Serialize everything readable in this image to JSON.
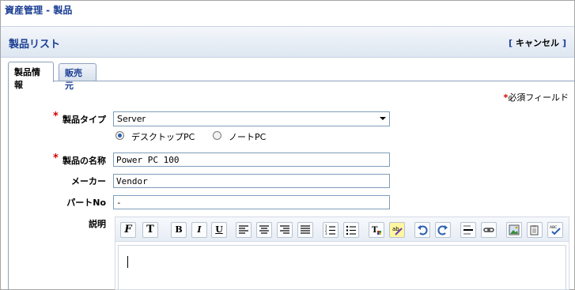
{
  "app": {
    "title": "資産管理 - 製品"
  },
  "header": {
    "title": "製品リスト",
    "cancel_open": "[",
    "cancel_label": "キャンセル",
    "cancel_close": "]"
  },
  "tabs": [
    {
      "label": "製品情報",
      "active": true
    },
    {
      "label": "販売元",
      "active": false
    }
  ],
  "form": {
    "required_star": "*",
    "required_note": "必須フィールド",
    "product_type": {
      "label": "製品タイプ",
      "value": "Server"
    },
    "category": {
      "options": [
        {
          "label": "デスクトップPC",
          "checked": true
        },
        {
          "label": "ノートPC",
          "checked": false
        }
      ]
    },
    "product_name": {
      "label": "製品の名称",
      "value": "Power PC 100"
    },
    "manufacturer": {
      "label": "メーカー",
      "value": "Vendor"
    },
    "part_no": {
      "label": "パートNo",
      "value": "-"
    },
    "description": {
      "label": "説明",
      "value": ""
    }
  },
  "toolbar": {
    "icons": [
      "font-family-icon",
      "font-size-icon",
      "bold-icon",
      "italic-icon",
      "underline-icon",
      "align-left-icon",
      "align-center-icon",
      "align-right-icon",
      "justify-icon",
      "ordered-list-icon",
      "unordered-list-icon",
      "text-color-icon",
      "highlight-icon",
      "undo-icon",
      "redo-icon",
      "horizontal-rule-icon",
      "link-icon",
      "insert-image-icon",
      "paste-icon",
      "spellcheck-icon"
    ],
    "bold_label": "B",
    "italic_label": "I",
    "underline_label": "U",
    "font_label": "F",
    "size_label": "T"
  },
  "colors": {
    "accent": "#1c3f94",
    "required": "#d00000",
    "header_bg": "#dde6f1"
  }
}
